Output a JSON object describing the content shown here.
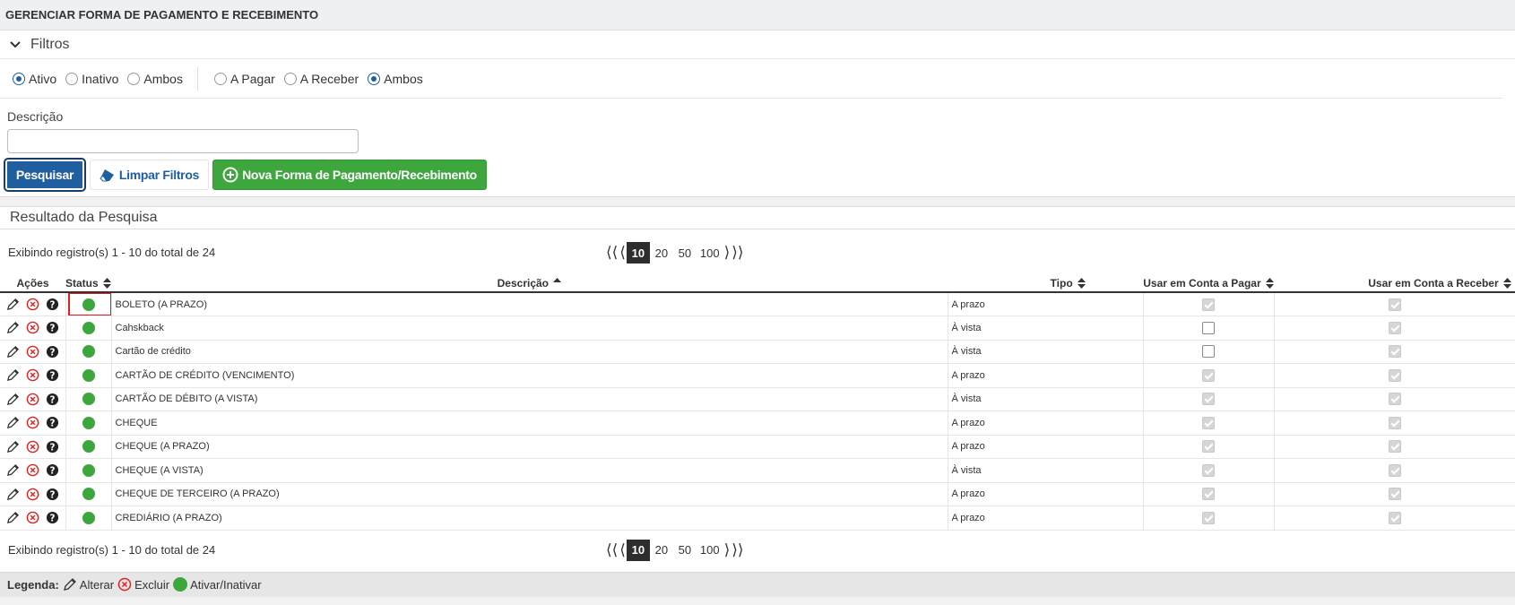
{
  "page": {
    "title": "GERENCIAR FORMA DE PAGAMENTO E RECEBIMENTO"
  },
  "filters": {
    "title": "Filtros",
    "status_options": [
      {
        "label": "Ativo",
        "selected": true
      },
      {
        "label": "Inativo",
        "selected": false
      },
      {
        "label": "Ambos",
        "selected": false
      }
    ],
    "type_options": [
      {
        "label": "A Pagar",
        "selected": false
      },
      {
        "label": "A Receber",
        "selected": false
      },
      {
        "label": "Ambos",
        "selected": true
      }
    ],
    "description_label": "Descrição",
    "description_value": "",
    "search_label": "Pesquisar",
    "clear_label": "Limpar Filtros",
    "new_label": "Nova Forma de Pagamento/Recebimento"
  },
  "results": {
    "title": "Resultado da Pesquisa",
    "records_text": "Exibindo registro(s) 1 - 10 do total de 24",
    "pager": {
      "sizes": [
        "10",
        "20",
        "50",
        "100"
      ],
      "active": "10"
    },
    "columns": {
      "actions": "Ações",
      "status": "Status",
      "description": "Descrição",
      "type": "Tipo",
      "pay": "Usar em Conta a Pagar",
      "receive": "Usar em Conta a Receber"
    },
    "rows": [
      {
        "description": "BOLETO (A PRAZO)",
        "type": "A prazo",
        "pay": true,
        "receive": true
      },
      {
        "description": "Cahskback",
        "type": "À vista",
        "pay": false,
        "receive": true
      },
      {
        "description": "Cartão de crédito",
        "type": "À vista",
        "pay": false,
        "receive": true
      },
      {
        "description": "CARTÃO DE CRÉDITO (VENCIMENTO)",
        "type": "A prazo",
        "pay": true,
        "receive": true
      },
      {
        "description": "CARTÃO DE DÉBITO (A VISTA)",
        "type": "À vista",
        "pay": true,
        "receive": true
      },
      {
        "description": "CHEQUE",
        "type": "A prazo",
        "pay": true,
        "receive": true
      },
      {
        "description": "CHEQUE (A PRAZO)",
        "type": "A prazo",
        "pay": true,
        "receive": true
      },
      {
        "description": "CHEQUE (A VISTA)",
        "type": "À vista",
        "pay": true,
        "receive": true
      },
      {
        "description": "CHEQUE DE TERCEIRO (A PRAZO)",
        "type": "A prazo",
        "pay": true,
        "receive": true
      },
      {
        "description": "CREDIÁRIO (A PRAZO)",
        "type": "A prazo",
        "pay": true,
        "receive": true
      }
    ],
    "highlighted_status_row": 0
  },
  "legend": {
    "title": "Legenda:",
    "edit": "Alterar",
    "delete": "Excluir",
    "toggle": "Ativar/Inativar"
  },
  "colors": {
    "primary": "#1f5f9f",
    "success": "#3da63d",
    "danger": "#e02020",
    "highlight": "#e02020"
  },
  "icons": {
    "collapse": "chevron-down-icon",
    "clear": "eraser-icon",
    "new": "plus-circle-icon",
    "edit": "pencil-icon",
    "delete": "close-circle-icon",
    "help": "question-circle-icon",
    "status": "green-dot-icon"
  }
}
